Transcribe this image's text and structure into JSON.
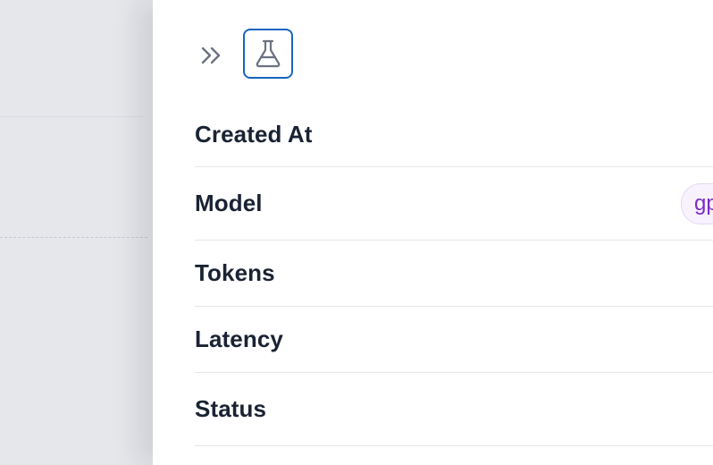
{
  "panel": {
    "collapse_icon": "double-chevron-right-icon",
    "flask_icon": "flask-icon",
    "accent_color": "#1565c0"
  },
  "details": {
    "rows": [
      {
        "label": "Created At"
      },
      {
        "label": "Model",
        "badge": "gp"
      },
      {
        "label": "Tokens"
      },
      {
        "label": "Latency"
      },
      {
        "label": "Status"
      }
    ],
    "badge_color": "#7b2cc4"
  }
}
